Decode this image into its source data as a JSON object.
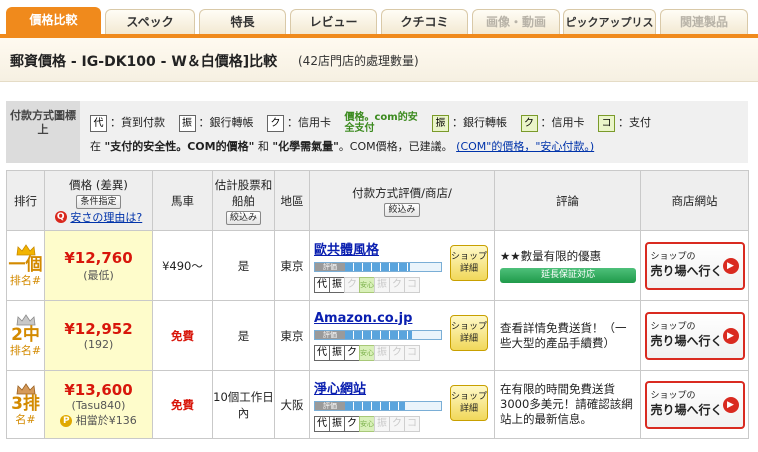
{
  "tabs": [
    {
      "label": "價格比較",
      "state": "active"
    },
    {
      "label": "スペック",
      "state": "normal"
    },
    {
      "label": "特長",
      "state": "normal"
    },
    {
      "label": "レビュー",
      "state": "normal"
    },
    {
      "label": "クチコミ",
      "state": "normal"
    },
    {
      "label": "画像・動画",
      "state": "disabled"
    },
    {
      "label": "ピックアップリスト",
      "state": "normal"
    },
    {
      "label": "関連製品",
      "state": "disabled"
    }
  ],
  "header": {
    "title": "郵資價格 - IG-DK100 - W＆白價格]比較",
    "count": "(42店門店的處理數量)"
  },
  "legend": {
    "label": "付款方式圖標上",
    "items": [
      {
        "icon": "代",
        "text": "：貨到付款"
      },
      {
        "icon": "振",
        "text": "：銀行轉帳"
      },
      {
        "icon": "ク",
        "text": "：信用卡"
      }
    ],
    "secure_label": "價格。com的安全支付",
    "secure_items": [
      {
        "icon": "振",
        "text": "：銀行轉帳"
      },
      {
        "icon": "ク",
        "text": "：信用卡"
      },
      {
        "icon": "コ",
        "text": "：支付"
      }
    ],
    "note_prefix": "在",
    "note_bold1": "\"支付的安全性。COM的價格\"",
    "note_and": "和",
    "note_bold2": "\"化學需氣量\"",
    "note_suffix": "。COM價格，已建議。",
    "note_link": "(COM\"的價格，\"安心付款。)"
  },
  "table": {
    "headers": {
      "rank": "排行",
      "price": "價格 (差異)",
      "price_btn": "条件指定",
      "price_why": "安さの理由は?",
      "shipping": "馬車",
      "delivery": "估計股票和船舶",
      "delivery_btn": "絞込み",
      "region": "地區",
      "payment": "付款方式評價/商店/",
      "payment_btn": "絞込み",
      "review": "評論",
      "site": "商店網站"
    },
    "rating_label": "評価",
    "detail_label": "ショップ詳細",
    "go_line1": "ショップの",
    "go_line2": "売り場へ行く",
    "rows": [
      {
        "rank_num": "一個",
        "rank_sub": "排名#",
        "price": "¥12,760",
        "diff": "(最低)",
        "shipping": "¥490～",
        "shipping_free": false,
        "delivery": "是",
        "region": "東京",
        "shop": "歐共體風格",
        "rating": 0.68,
        "review": "★★數量有限的優惠",
        "warranty": "延長保証対応",
        "extra": ""
      },
      {
        "rank_num": "2中",
        "rank_sub": "排名#",
        "price": "¥12,952",
        "diff": "(192)",
        "shipping": "免費",
        "shipping_free": true,
        "delivery": "是",
        "region": "東京",
        "shop": "Amazon.co.jp",
        "rating": 0.7,
        "review": "查看詳情免費送貨！（一些大型的產品手續費）",
        "warranty": "",
        "extra": ""
      },
      {
        "rank_num": "3排",
        "rank_sub": "名#",
        "price": "¥13,600",
        "diff": "(Tasu840)",
        "shipping": "免費",
        "shipping_free": true,
        "delivery": "10個工作日內",
        "region": "大阪",
        "shop": "淨心網站",
        "rating": 0.62,
        "review": "在有限的時間免費送貨3000多美元！請確認該網站上的最新信息。",
        "warranty": "",
        "extra": "相當於¥136"
      }
    ]
  },
  "colors": {
    "accent": "#f08a1c",
    "price": "#d8160b",
    "link": "#0a1fb0"
  }
}
